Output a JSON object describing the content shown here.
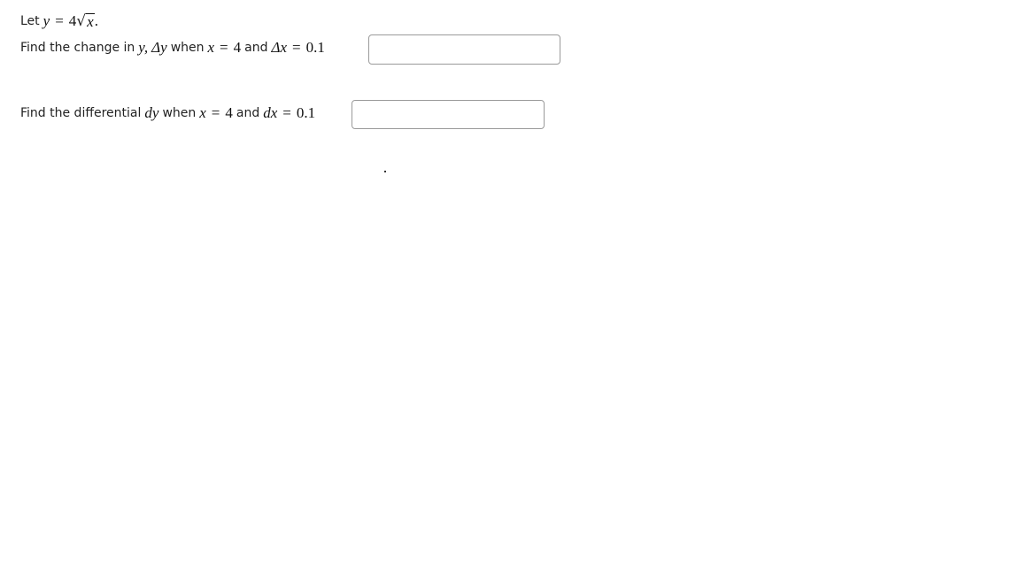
{
  "problem": {
    "intro": {
      "prefix": "Let",
      "var_y": "y",
      "equals": "=",
      "coef": "4",
      "radical": "√",
      "radicand": "x",
      "period": "."
    },
    "part1": {
      "text1": "Find the change in",
      "var_y": "y,",
      "delta_y": "Δy",
      "text2": "when",
      "var_x": "x",
      "equals1": "=",
      "x_value": "4",
      "text3": "and",
      "delta_x": "Δx",
      "equals2": "=",
      "dx_value": "0.1",
      "answer_value": ""
    },
    "part2": {
      "text1": "Find the differential",
      "dy": "dy",
      "text2": "when",
      "var_x": "x",
      "equals1": "=",
      "x_value": "4",
      "text3": "and",
      "dx": "dx",
      "equals2": "=",
      "dx_value": "0.1",
      "answer_value": ""
    }
  }
}
